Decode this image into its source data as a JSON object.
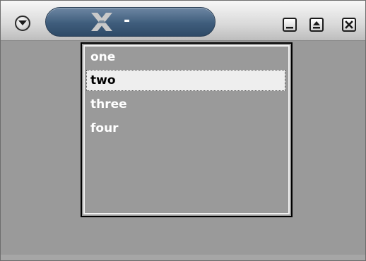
{
  "window": {
    "title": "-",
    "title_icon": "x-logo-icon",
    "buttons": {
      "menu": "chevron-down-icon",
      "minimize": "minimize-icon",
      "maximize": "maximize-icon",
      "close": "close-icon"
    }
  },
  "list": {
    "items": [
      {
        "label": "one",
        "selected": false
      },
      {
        "label": "two",
        "selected": true
      },
      {
        "label": "three",
        "selected": false
      },
      {
        "label": "four",
        "selected": false
      }
    ]
  },
  "colors": {
    "window_bg": "#9a9a9a",
    "title_pill": "#3f5d7c",
    "selection_bg": "#eeeeee",
    "item_text": "#ffffff"
  }
}
